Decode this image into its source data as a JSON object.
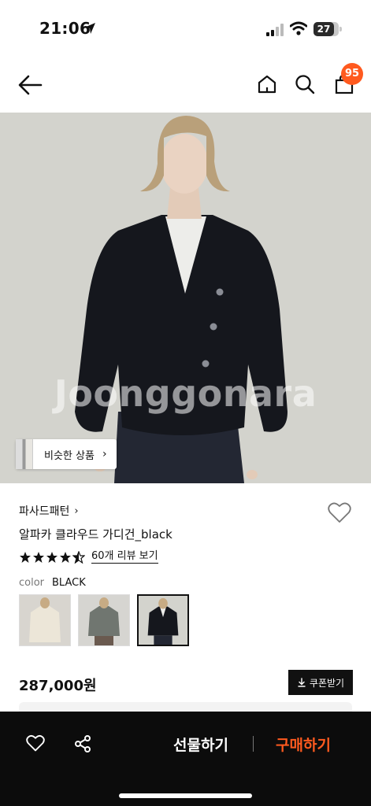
{
  "status_bar": {
    "time": "21:06",
    "battery": "27"
  },
  "nav": {
    "cart_count": "95"
  },
  "hero": {
    "watermark": "Joonggonara",
    "similar_label": "비슷한 상품"
  },
  "product": {
    "brand": "파사드패턴",
    "name": "알파카 클라우드 가디건_black",
    "rating": 4.5,
    "review_link": "60개 리뷰 보기",
    "color_key": "color",
    "color_value": "BLACK",
    "swatches": [
      "ivory",
      "gray",
      "black"
    ],
    "selected_swatch": "black",
    "price": "287,000원",
    "coupon_label": "쿠폰받기"
  },
  "bottom_bar": {
    "gift_label": "선물하기",
    "buy_label": "구매하기"
  },
  "colors": {
    "accent": "#ff5a1f",
    "dark": "#0c0c0c"
  },
  "icons": [
    "location-arrow-icon",
    "signal-icon",
    "wifi-icon",
    "battery-icon",
    "back-arrow-icon",
    "home-icon",
    "search-icon",
    "shopping-bag-icon",
    "heart-icon",
    "star-icon",
    "download-icon",
    "share-icon",
    "chevron-right-icon"
  ]
}
